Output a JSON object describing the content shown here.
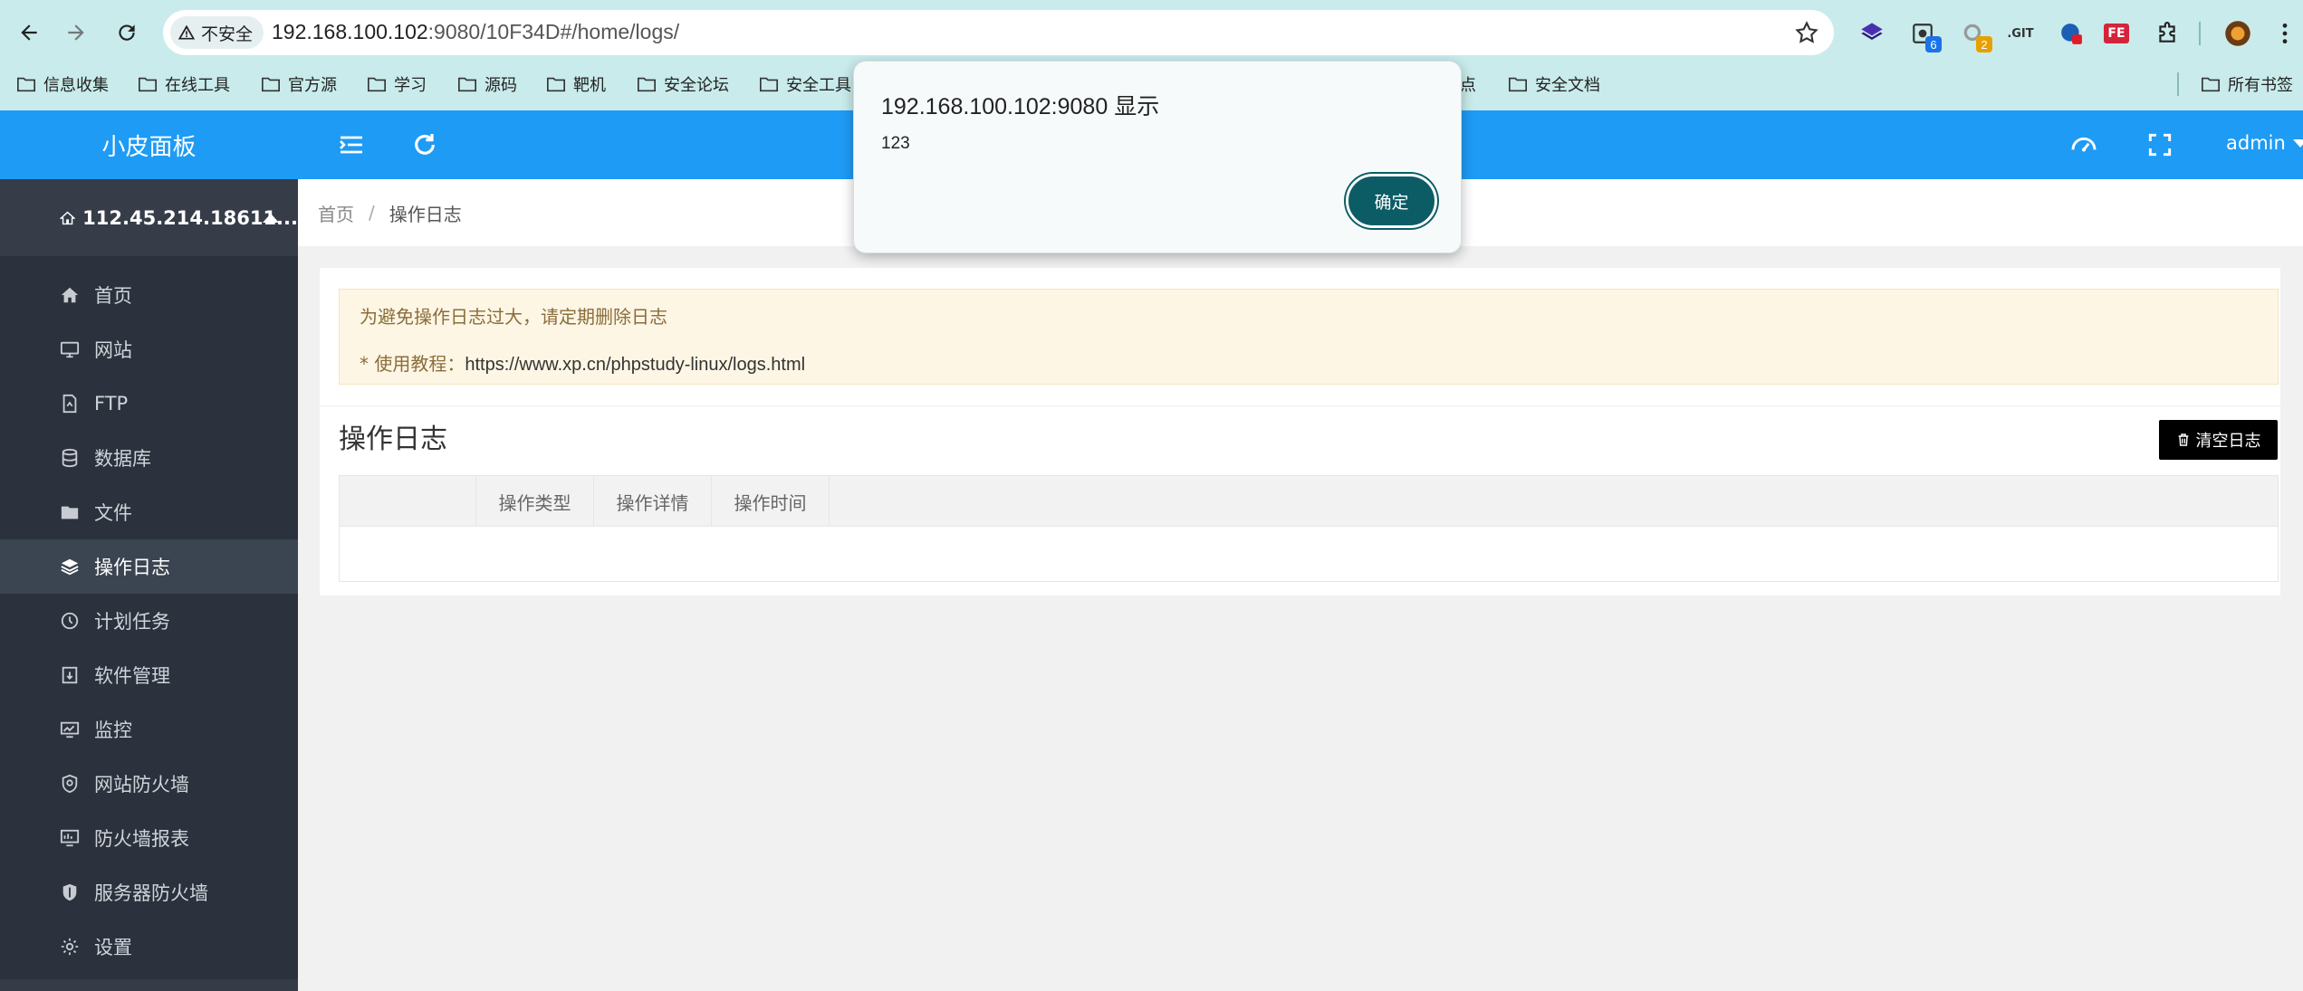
{
  "browser": {
    "insecure_label": "不安全",
    "url_host": "192.168.100.102",
    "url_rest": ":9080/10F34D#/home/logs/",
    "extensions": [
      {
        "name": "layers-ext",
        "badge": ""
      },
      {
        "name": "capture-ext",
        "badge": "6"
      },
      {
        "name": "search-ext",
        "badge": "2"
      },
      {
        "name": "git-ext",
        "label": ".GIT",
        "badge": ""
      },
      {
        "name": "globe-ext",
        "badge": ""
      },
      {
        "name": "fe-ext",
        "label": "FE",
        "badge": ""
      },
      {
        "name": "puzzle-ext",
        "badge": ""
      },
      {
        "name": "profile-avatar",
        "badge": ""
      }
    ],
    "bookmarks": [
      "信息收集",
      "在线工具",
      "官方源",
      "学习",
      "源码",
      "靶机",
      "安全论坛",
      "安全工具",
      "点",
      "安全文档"
    ],
    "all_bookmarks": "所有书签"
  },
  "app": {
    "brand": "小皮面板",
    "server": "112.45.214.18611...",
    "menu": [
      {
        "label": "首页",
        "icon": "home-icon"
      },
      {
        "label": "网站",
        "icon": "monitor-icon"
      },
      {
        "label": "FTP",
        "icon": "ftp-icon"
      },
      {
        "label": "数据库",
        "icon": "database-icon"
      },
      {
        "label": "文件",
        "icon": "folder-icon"
      },
      {
        "label": "操作日志",
        "icon": "layers-icon",
        "active": true
      },
      {
        "label": "计划任务",
        "icon": "clock-icon"
      },
      {
        "label": "软件管理",
        "icon": "download-icon"
      },
      {
        "label": "监控",
        "icon": "chart-icon"
      },
      {
        "label": "网站防火墙",
        "icon": "shield-icon"
      },
      {
        "label": "防火墙报表",
        "icon": "report-icon"
      },
      {
        "label": "服务器防火墙",
        "icon": "shield-solid-icon"
      },
      {
        "label": "设置",
        "icon": "gear-icon"
      }
    ],
    "user": "admin"
  },
  "breadcrumb": {
    "home": "首页",
    "sep": "/",
    "current": "操作日志"
  },
  "notice": {
    "line1": "为避免操作日志过大，请定期删除日志",
    "line2_prefix": "* 使用教程：",
    "line2_link": "https://www.xp.cn/phpstudy-linux/logs.html"
  },
  "logs": {
    "title": "操作日志",
    "clear_button": "清空日志",
    "columns": [
      "操作类型",
      "操作详情",
      "操作时间"
    ]
  },
  "dialog": {
    "title": "192.168.100.102:9080 显示",
    "message": "123",
    "ok": "确定"
  }
}
